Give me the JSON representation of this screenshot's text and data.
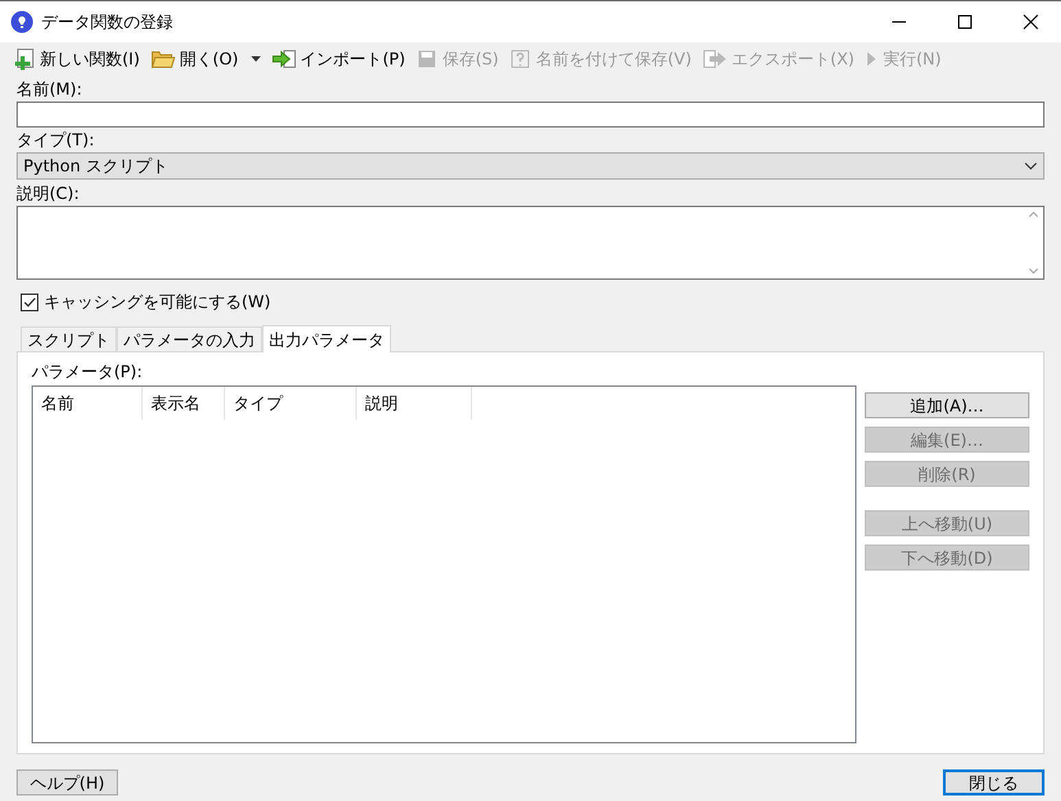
{
  "window": {
    "title": "データ関数の登録"
  },
  "toolbar": [
    {
      "label": "新しい関数(I)",
      "kind": "new",
      "disabled": false,
      "dropdown": false
    },
    {
      "label": "開く(O)",
      "kind": "open",
      "disabled": false,
      "dropdown": true
    },
    {
      "label": "インポート(P)",
      "kind": "import",
      "disabled": false,
      "dropdown": false
    },
    {
      "label": "保存(S)",
      "kind": "save",
      "disabled": true,
      "dropdown": false
    },
    {
      "label": "名前を付けて保存(V)",
      "kind": "saveas",
      "disabled": true,
      "dropdown": false
    },
    {
      "label": "エクスポート(X)",
      "kind": "export",
      "disabled": true,
      "dropdown": false
    },
    {
      "label": "実行(N)",
      "kind": "run",
      "disabled": true,
      "dropdown": false
    }
  ],
  "name": {
    "label": "名前(M):"
  },
  "type": {
    "label": "タイプ(T):",
    "value": "Python スクリプト"
  },
  "description": {
    "label": "説明(C):"
  },
  "caching": {
    "label": "キャッシングを可能にする(W)",
    "checked": true
  },
  "tabs": [
    {
      "label": "スクリプト",
      "selected": false
    },
    {
      "label": "パラメータの入力",
      "selected": false
    },
    {
      "label": "出力パラメータ",
      "selected": true
    }
  ],
  "parameters": {
    "label": "パラメータ(P):",
    "columns": [
      "名前",
      "表示名",
      "タイプ",
      "説明"
    ]
  },
  "side_buttons": [
    {
      "label": "追加(A)…",
      "disabled": false
    },
    {
      "label": "編集(E)…",
      "disabled": true
    },
    {
      "label": "削除(R)",
      "disabled": true
    },
    {
      "label": "上へ移動(U)",
      "disabled": true
    },
    {
      "label": "下へ移動(D)",
      "disabled": true
    }
  ],
  "help_button": "ヘルプ(H)",
  "close_button": "閉じる"
}
